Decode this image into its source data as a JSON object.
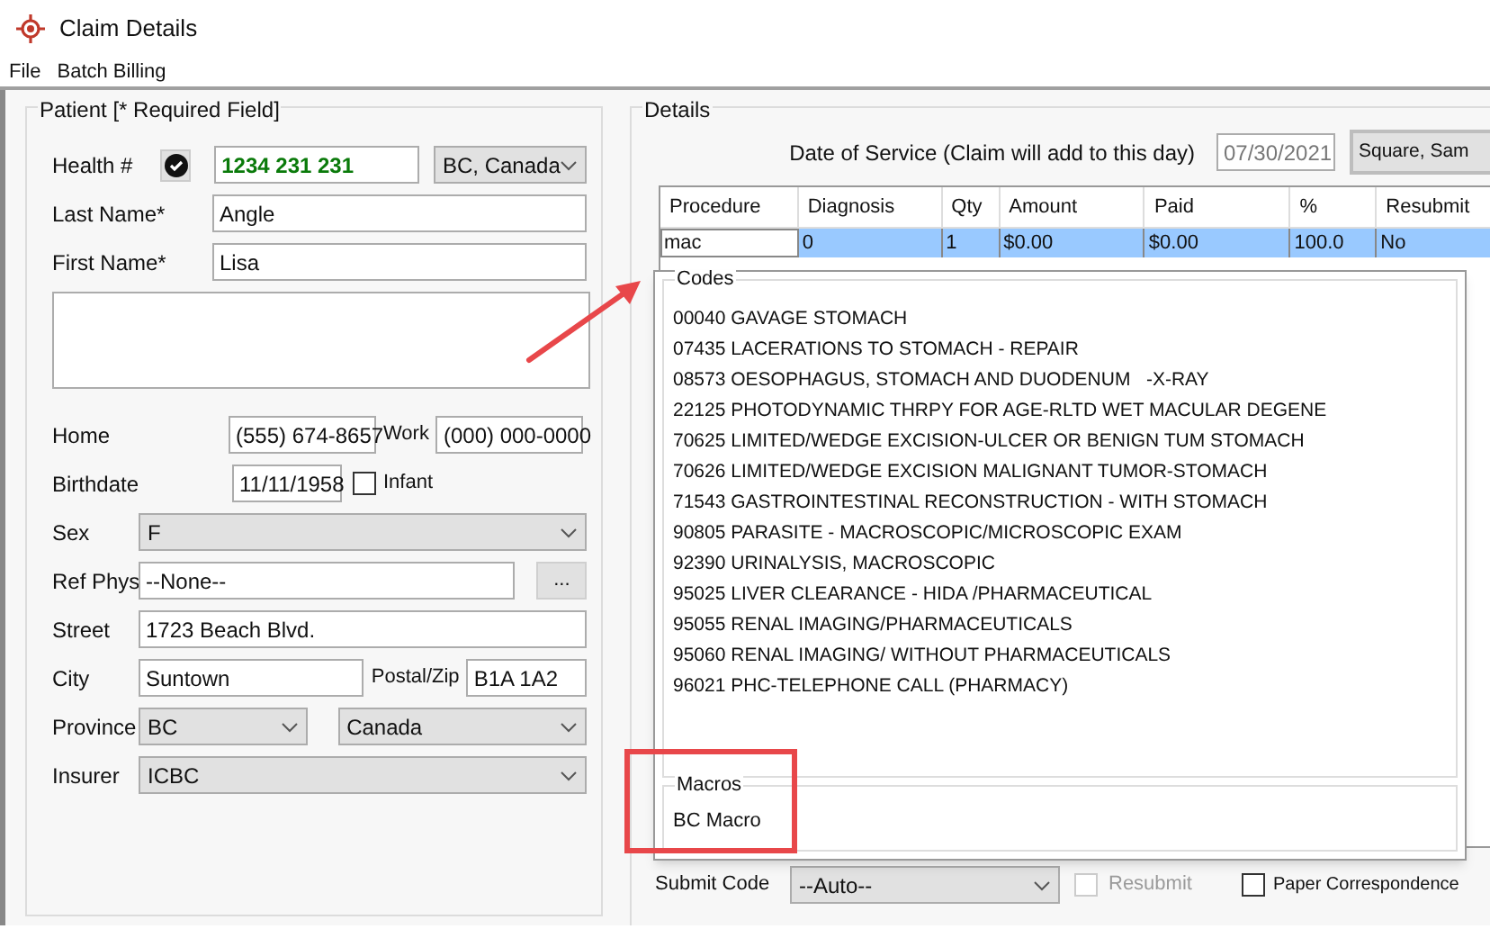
{
  "window": {
    "title": "Claim Details"
  },
  "menu": [
    "File",
    "Batch Billing"
  ],
  "patient": {
    "title": "Patient [* Required Field]",
    "health": {
      "label": "Health #",
      "verified": true,
      "value": "1234 231 231",
      "region": "BC, Canada"
    },
    "last_name": {
      "label": "Last Name*",
      "value": "Angle"
    },
    "first_name": {
      "label": "First Name*",
      "value": "Lisa"
    },
    "home": {
      "label": "Home",
      "value": "(555) 674-8657"
    },
    "work": {
      "label": "Work",
      "value": "(000) 000-0000"
    },
    "birthdate": {
      "label": "Birthdate",
      "value": "11/11/1958"
    },
    "infant": {
      "label": "Infant",
      "checked": false
    },
    "sex": {
      "label": "Sex",
      "value": "F"
    },
    "ref_phys": {
      "label": "Ref Phys",
      "value": "--None--",
      "button": "..."
    },
    "street": {
      "label": "Street",
      "value": "1723 Beach Blvd."
    },
    "city": {
      "label": "City",
      "value": "Suntown"
    },
    "postal": {
      "label": "Postal/Zip",
      "value": "B1A 1A2"
    },
    "province": {
      "label": "Province",
      "value": "BC",
      "country": "Canada"
    },
    "insurer": {
      "label": "Insurer",
      "value": "ICBC"
    }
  },
  "details": {
    "title": "Details",
    "date_label": "Date of Service (Claim will add to this day)",
    "date": "07/30/2021",
    "provider": "Square, Sam",
    "table": {
      "columns": [
        "Procedure",
        "Diagnosis",
        "Qty",
        "Amount",
        "Paid",
        "%",
        "Resubmit"
      ],
      "rows": [
        {
          "selected": true,
          "cells": [
            "mac",
            "0",
            "1",
            "$0.00",
            "$0.00",
            "100.0",
            "No"
          ]
        }
      ]
    },
    "popup": {
      "codes_title": "Codes",
      "codes": [
        "00040 GAVAGE STOMACH",
        "07435 LACERATIONS TO STOMACH - REPAIR",
        "08573 OESOPHAGUS, STOMACH AND DUODENUM   -X-RAY",
        "22125 PHOTODYNAMIC THRPY FOR AGE-RLTD WET MACULAR DEGENE",
        "70625 LIMITED/WEDGE EXCISION-ULCER OR BENIGN TUM STOMACH",
        "70626 LIMITED/WEDGE EXCISION MALIGNANT TUMOR-STOMACH",
        "71543 GASTROINTESTINAL RECONSTRUCTION - WITH STOMACH",
        "90805 PARASITE - MACROSCOPIC/MICROSCOPIC EXAM",
        "92390 URINALYSIS, MACROSCOPIC",
        "95025 LIVER CLEARANCE - HIDA /PHARMACEUTICAL",
        "95055 RENAL IMAGING/PHARMACEUTICALS",
        "95060 RENAL IMAGING/ WITHOUT PHARMACEUTICALS",
        "96021 PHC-TELEPHONE CALL (PHARMACY)"
      ],
      "macros_title": "Macros",
      "macros": [
        "BC Macro"
      ]
    },
    "submit_code": {
      "label": "Submit Code",
      "value": "--Auto--"
    },
    "resubmit": {
      "label": "Resubmit",
      "checked": false,
      "disabled": true
    },
    "paper": {
      "label": "Paper Correspondence",
      "checked": false
    }
  }
}
